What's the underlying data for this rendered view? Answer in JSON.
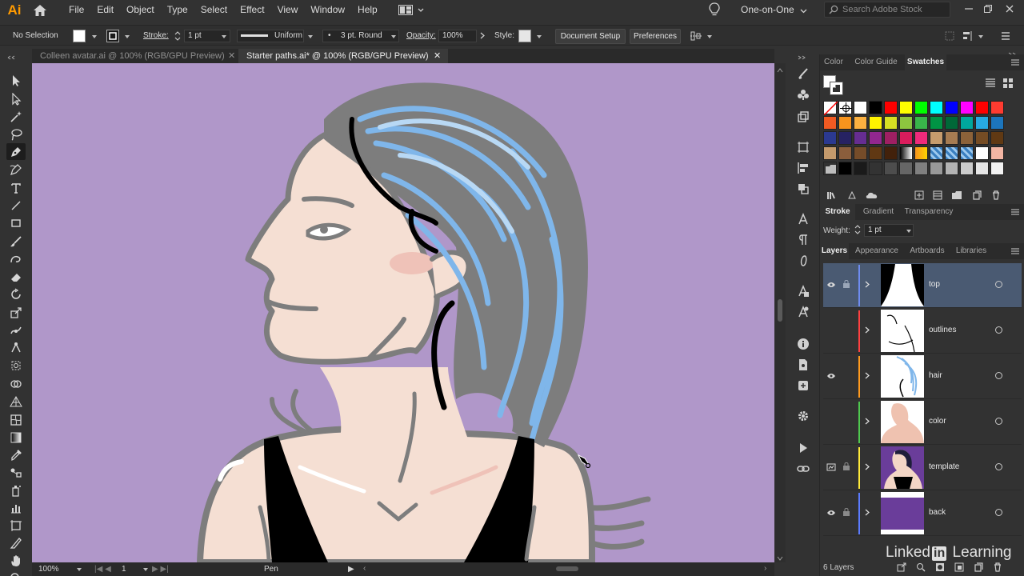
{
  "app": {
    "logo": "Ai",
    "accent": "#ff9a00"
  },
  "menu": [
    "File",
    "Edit",
    "Object",
    "Type",
    "Select",
    "Effect",
    "View",
    "Window",
    "Help"
  ],
  "workspace": "One-on-One",
  "search_placeholder": "Search Adobe Stock",
  "control_bar": {
    "selection": "No Selection",
    "stroke_label": "Stroke:",
    "stroke_value": "1 pt",
    "profile": "Uniform",
    "brush": "3 pt. Round",
    "opacity_label": "Opacity:",
    "opacity_value": "100%",
    "style_label": "Style:",
    "document_setup": "Document Setup",
    "preferences": "Preferences"
  },
  "tabs": [
    {
      "label": "Colleen avatar.ai @ 100% (RGB/GPU Preview)",
      "active": false
    },
    {
      "label": "Starter paths.ai* @ 100% (RGB/GPU Preview)",
      "active": true
    }
  ],
  "status": {
    "zoom": "100%",
    "artboard": "1",
    "tool": "Pen"
  },
  "swatch_panel": {
    "tabs": [
      "Color",
      "Color Guide",
      "Swatches"
    ]
  },
  "swatches": [
    [
      "none",
      "reg",
      "#ffffff",
      "#000000",
      "#ff0000",
      "#ffff00",
      "#00ff00",
      "#00ffff",
      "#0000ff",
      "#ff00ff",
      "#ff0000",
      "#ff3b30"
    ],
    [
      "#f05a22",
      "#f7941d",
      "#fbb040",
      "#fff200",
      "#d7df23",
      "#8dc63f",
      "#39b54a",
      "#009444",
      "#006838",
      "#00a79d",
      "#27aae1",
      "#1c75bc"
    ],
    [
      "#2b3990",
      "#262262",
      "#662d91",
      "#92278f",
      "#9e1f63",
      "#da1c5c",
      "#ee2a7b",
      "#c69c6d",
      "#a67c52",
      "#8c6239",
      "#754c24",
      "#603913"
    ],
    [
      "#c49a6c",
      "#8b5e3c",
      "#754c29",
      "#603813",
      "#42210b",
      "#gradient1",
      "#gradient2",
      "#pattern1",
      "#pattern2",
      "#pattern3",
      "#ffffff",
      "#f2b5a3"
    ],
    [
      "folder",
      "#000000",
      "#1a1a1a",
      "#333333",
      "#4d4d4d",
      "#666666",
      "#808080",
      "#999999",
      "#b3b3b3",
      "#cccccc",
      "#e6e6e6",
      "#f2f2f2"
    ]
  ],
  "stroke_panel": {
    "tabs": [
      "Stroke",
      "Gradient",
      "Transparency"
    ],
    "weight_label": "Weight:",
    "weight_value": "1 pt"
  },
  "layers_panel": {
    "tabs": [
      "Layers",
      "Appearance",
      "Artboards",
      "Libraries"
    ],
    "layers": [
      {
        "name": "top",
        "color": "#6e8cf0",
        "visible": true,
        "locked": true,
        "selected": true
      },
      {
        "name": "outlines",
        "color": "#ff4040",
        "visible": false,
        "locked": false,
        "selected": false
      },
      {
        "name": "hair",
        "color": "#ff9a1e",
        "visible": true,
        "locked": false,
        "selected": false
      },
      {
        "name": "color",
        "color": "#4fc84f",
        "visible": false,
        "locked": false,
        "selected": false
      },
      {
        "name": "template",
        "color": "#ffea3a",
        "visible": true,
        "locked": true,
        "selected": false
      },
      {
        "name": "back",
        "color": "#5b7bff",
        "visible": true,
        "locked": true,
        "selected": false
      }
    ],
    "count": "6 Layers"
  },
  "watermark": "Linked in Learning"
}
